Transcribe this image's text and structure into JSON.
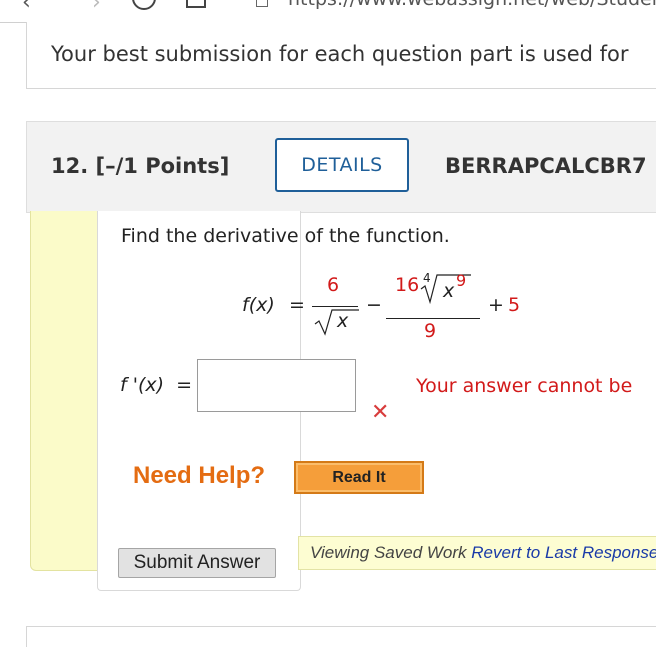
{
  "browser": {
    "url": "https://www.webassign.net/web/Student/"
  },
  "info": {
    "text": "Your best submission for each question part is used for"
  },
  "question": {
    "number_label": "12.",
    "points_label": "[–/1 Points]",
    "details_label": "DETAILS",
    "code": "BERRAPCALCBR7",
    "prompt": "Find the derivative of the function.",
    "function": {
      "name": "f(x)",
      "equals": "=",
      "term1_numerator": "6",
      "term1_denominator_radicand": "x",
      "minus": "−",
      "term2_coefficient": "16",
      "term2_root_index": "4",
      "term2_radicand_base": "x",
      "term2_radicand_exponent": "9",
      "term2_denominator": "9",
      "plus": "+",
      "constant": "5"
    },
    "answer": {
      "label": "f '(x)",
      "equals": "=",
      "value": "",
      "status_text": "Your answer cannot be"
    },
    "help": {
      "need_help_label": "Need Help?",
      "read_it_label": "Read It"
    },
    "submit_label": "Submit Answer",
    "saved_work": {
      "label": "Viewing Saved Work",
      "revert_link": "Revert to Last Response"
    }
  },
  "colors": {
    "accent_blue": "#1f5f99",
    "error_red": "#d21a1a",
    "help_orange": "#e46c12",
    "yellow_strip": "#fbfbc9"
  }
}
